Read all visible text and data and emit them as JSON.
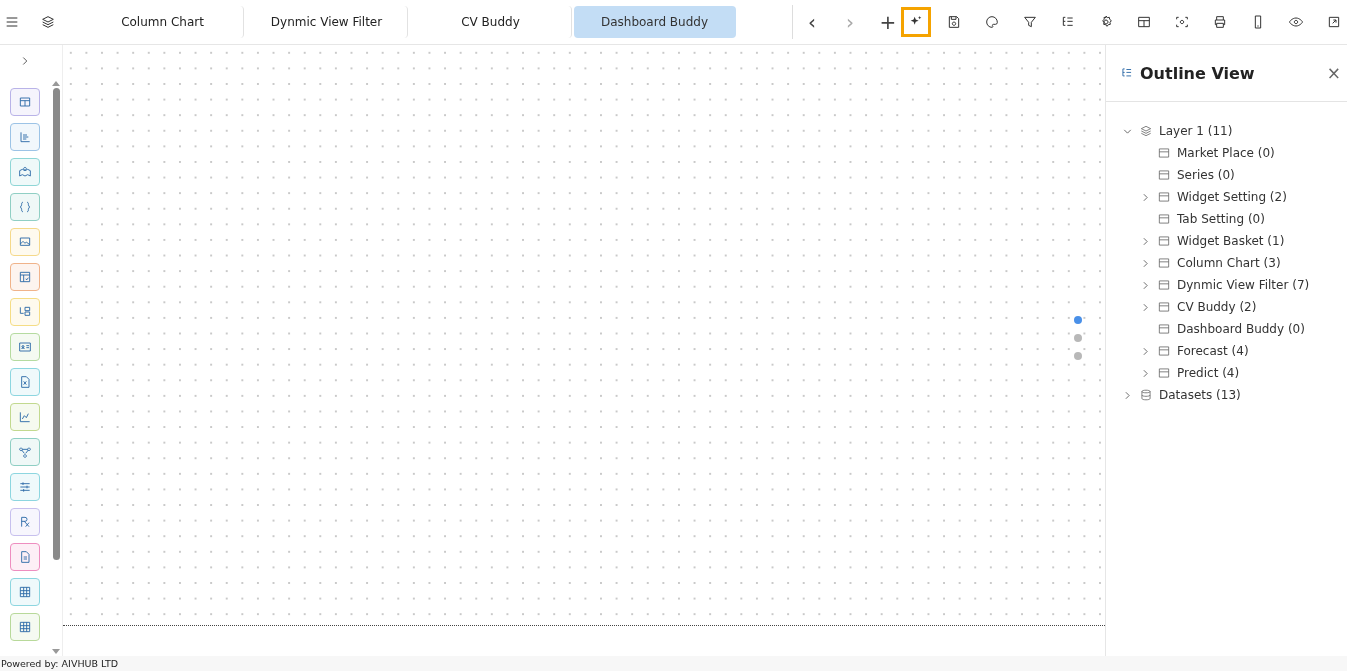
{
  "tabs": [
    {
      "label": "Column Chart",
      "selected": false
    },
    {
      "label": "Dynmic View Filter",
      "selected": false
    },
    {
      "label": "CV Buddy",
      "selected": false
    },
    {
      "label": "Dashboard Buddy",
      "selected": true
    }
  ],
  "tab_nav": {
    "back": "‹",
    "forward": "›",
    "add": "+"
  },
  "toolbar": [
    {
      "selected": true
    },
    {
      "selected": false
    },
    {
      "selected": false
    },
    {
      "selected": false
    },
    {
      "selected": false
    },
    {
      "selected": false
    },
    {
      "selected": false
    },
    {
      "selected": false
    },
    {
      "selected": false
    },
    {
      "selected": false
    },
    {
      "selected": false
    },
    {
      "selected": false
    }
  ],
  "palette": [
    {
      "color": "#b9b3e8"
    },
    {
      "color": "#9cc3e6"
    },
    {
      "color": "#8fd6d6"
    },
    {
      "color": "#90cfc4"
    },
    {
      "color": "#f5d98a"
    },
    {
      "color": "#f0b38a"
    },
    {
      "color": "#f5dd85"
    },
    {
      "color": "#b5dba0"
    },
    {
      "color": "#8dd6e0"
    },
    {
      "color": "#c2d98f"
    },
    {
      "color": "#8fcfc4"
    },
    {
      "color": "#8dd6e0"
    },
    {
      "color": "#c7c0ee"
    },
    {
      "color": "#ee8ec0"
    },
    {
      "color": "#8dd6e0"
    },
    {
      "color": "#b8d99a"
    }
  ],
  "pager": [
    {
      "selected": true
    },
    {
      "selected": false
    },
    {
      "selected": false
    }
  ],
  "outline": {
    "title": "Outline View",
    "close": "×",
    "tree": [
      {
        "label": "Layer 1 (11)",
        "kind": "layer",
        "expanded": true,
        "children": [
          {
            "label": "Market Place (0)",
            "kind": "widget"
          },
          {
            "label": "Series (0)",
            "kind": "widget"
          },
          {
            "label": "Widget Setting (2)",
            "kind": "widget",
            "expanded": false
          },
          {
            "label": "Tab Setting (0)",
            "kind": "widget"
          },
          {
            "label": "Widget Basket (1)",
            "kind": "widget",
            "expanded": false
          },
          {
            "label": "Column Chart (3)",
            "kind": "widget",
            "expanded": false
          },
          {
            "label": "Dynmic View Filter (7)",
            "kind": "widget",
            "expanded": false
          },
          {
            "label": "CV Buddy (2)",
            "kind": "widget",
            "expanded": false
          },
          {
            "label": "Dashboard Buddy (0)",
            "kind": "widget"
          },
          {
            "label": "Forecast (4)",
            "kind": "widget",
            "expanded": false
          },
          {
            "label": "Predict (4)",
            "kind": "widget",
            "expanded": false
          }
        ]
      },
      {
        "label": "Datasets (13)",
        "kind": "dataset",
        "expanded": false
      }
    ]
  },
  "footer": "Powered by: AIVHUB LTD"
}
